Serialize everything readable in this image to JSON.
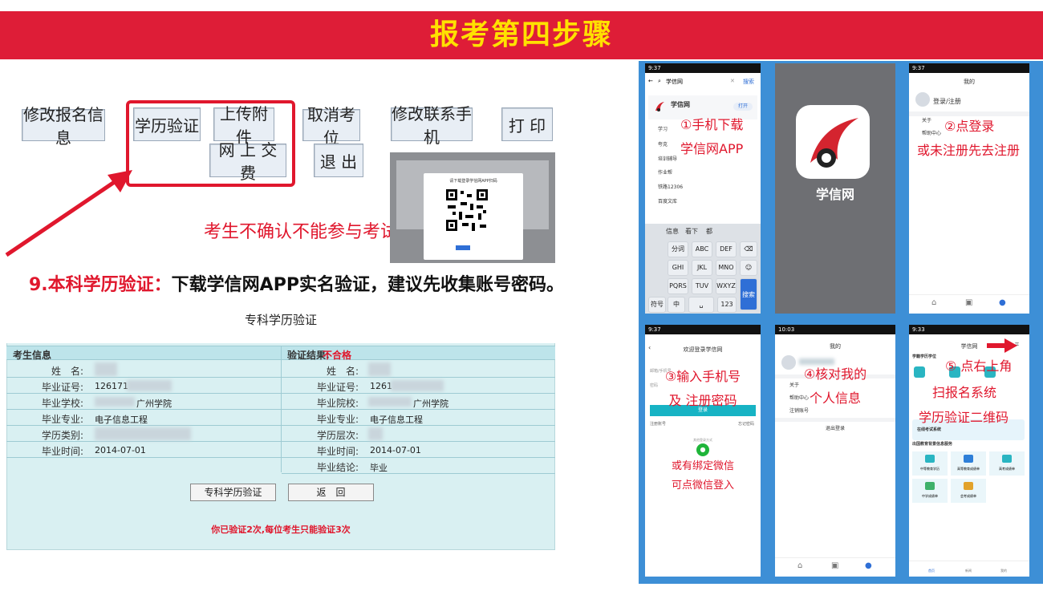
{
  "title": "报考第四步骤",
  "buttons": {
    "modify_info": "修改报名信息",
    "edu_verify": "学历验证",
    "upload": "上传附件",
    "cancel": "取消考位",
    "modify_phone": "修改联系手机",
    "print": "打 印",
    "pay": "网 上 交 费",
    "exit": "退 出"
  },
  "note": "考生不确认不能参与考试。",
  "caption": {
    "prefix": "9.本科学历验证：",
    "text": "下载学信网APP实名验证，建议先收集账号密码。"
  },
  "verify_panel": {
    "title": "专科学历验证",
    "left_header": "考生信息",
    "right_header_label": "验证结果:",
    "right_header_value": "不合格",
    "rows_left": [
      {
        "label": "姓　名:",
        "value": ""
      },
      {
        "label": "毕业证号:",
        "value": "126171"
      },
      {
        "label": "毕业学校:",
        "value": "广州学院"
      },
      {
        "label": "毕业专业:",
        "value": "电子信息工程"
      },
      {
        "label": "学历类别:",
        "value": ""
      },
      {
        "label": "毕业时间:",
        "value": "2014-07-01"
      }
    ],
    "rows_right": [
      {
        "label": "姓　名:",
        "value": ""
      },
      {
        "label": "毕业证号:",
        "value": "1261"
      },
      {
        "label": "毕业院校:",
        "value": "广州学院"
      },
      {
        "label": "毕业专业:",
        "value": "电子信息工程"
      },
      {
        "label": "学历层次:",
        "value": ""
      },
      {
        "label": "毕业时间:",
        "value": "2014-07-01"
      },
      {
        "label": "毕业结论:",
        "value": "毕业"
      }
    ],
    "verify_button": "专科学历验证",
    "back_button": "返　回",
    "warning": "你已验证2次,每位考生只能验证3次"
  },
  "qr_dialog": {
    "text": "请下载登录学信网APP扫码"
  },
  "phones": {
    "p1": {
      "time": "9:37",
      "search_text": "学信网",
      "search_btn": "搜索",
      "app_name": "学信网",
      "open_btn": "打开",
      "list": [
        "学习",
        "夸克",
        "培训辅导",
        "作业帮",
        "铁路12306",
        "百度文库"
      ],
      "suggest": [
        "信息",
        "看下",
        "都"
      ],
      "keys": [
        "分词",
        "ABC",
        "DEF",
        "GHI",
        "JKL",
        "MNO",
        "PQRS",
        "TUV",
        "WXYZ"
      ],
      "bottom_keys": [
        "符号",
        "中",
        "123"
      ],
      "search_key": "搜索",
      "ann1": "①手机下载",
      "ann2": "学信网APP"
    },
    "p2": {
      "app_label": "学信网"
    },
    "p3": {
      "time": "9:37",
      "header": "我的",
      "login": "登录/注册",
      "items": [
        "关于",
        "帮助中心"
      ],
      "ann1": "②点登录",
      "ann2": "或未注册先去注册"
    },
    "p4": {
      "time": "9:37",
      "header": "欢迎登录学信网",
      "field1": "邮箱/手机号",
      "field2": "密码",
      "login_btn": "登录",
      "link_left": "注册账号",
      "link_right": "忘记密码",
      "other": "其他登录方式",
      "ann1": "③输入手机号",
      "ann2": "及 注册密码",
      "ann3": "或有绑定微信",
      "ann4": "可点微信登入"
    },
    "p5": {
      "time": "10:03",
      "header": "我的",
      "items": [
        "关于",
        "帮助中心",
        "注销账号"
      ],
      "logout": "退出登录",
      "ann1": "④核对我的",
      "ann2": "个人信息"
    },
    "p6": {
      "time": "9:33",
      "header": "学信网",
      "section1": "学籍学历学位",
      "banner": "在线考试系统",
      "section2": "出国教育背景信息服务",
      "tiles": [
        "中等教育学历",
        "高等教育成绩单",
        "高考成绩单",
        "中学成绩单",
        "会考成绩单"
      ],
      "tabs": [
        "首页",
        "新闻",
        "我的"
      ],
      "ann1": "⑤ 点右上角",
      "ann2": "扫报名系统",
      "ann3": "学历验证二维码"
    }
  },
  "colors": {
    "banner": "#de1d37",
    "title": "#ffe100",
    "accent_red": "#e0172d",
    "phone_frame": "#3d8fd6",
    "panel": "#d9f0f2"
  }
}
